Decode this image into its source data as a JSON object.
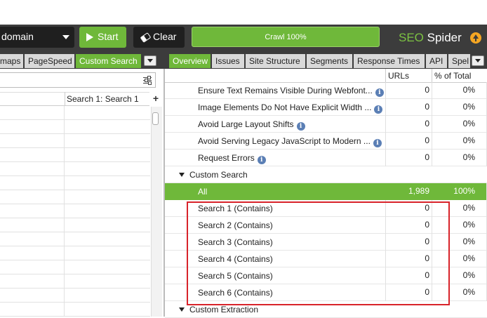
{
  "toolbar": {
    "mode_value": "domain",
    "start_label": "Start",
    "clear_label": "Clear",
    "progress_label": "Crawl 100%",
    "progress_fraction": 1.0
  },
  "brand": {
    "seo": "SEO",
    "spider": "Spider"
  },
  "left_tabs": [
    {
      "label": "maps"
    },
    {
      "label": "PageSpeed"
    },
    {
      "label": "Custom Search",
      "active": true
    }
  ],
  "right_tabs": [
    {
      "label": "Overview",
      "active": true
    },
    {
      "label": "Issues"
    },
    {
      "label": "Site Structure"
    },
    {
      "label": "Segments"
    },
    {
      "label": "Response Times"
    },
    {
      "label": "API"
    },
    {
      "label": "Spel"
    }
  ],
  "left_table": {
    "column": "Search 1: Search 1",
    "add_column": "+"
  },
  "overview": {
    "col_urls": "URLs",
    "col_pct": "% of Total",
    "rows": [
      {
        "label": "Ensure Text Remains Visible During Webfont...",
        "urls": "0",
        "pct": "0%",
        "info": true
      },
      {
        "label": "Image Elements Do Not Have Explicit Width ...",
        "urls": "0",
        "pct": "0%",
        "info": true
      },
      {
        "label": "Avoid Large Layout Shifts",
        "urls": "0",
        "pct": "0%",
        "info": true
      },
      {
        "label": "Avoid Serving Legacy JavaScript to Modern ...",
        "urls": "0",
        "pct": "0%",
        "info": true
      },
      {
        "label": "Request Errors",
        "urls": "0",
        "pct": "0%",
        "info": true
      },
      {
        "label": "Custom Search",
        "group": true
      },
      {
        "label": "All",
        "urls": "1,989",
        "pct": "100%",
        "selected": true
      },
      {
        "label": "Search 1 (Contains)",
        "urls": "0",
        "pct": "0%"
      },
      {
        "label": "Search 2 (Contains)",
        "urls": "0",
        "pct": "0%"
      },
      {
        "label": "Search 3 (Contains)",
        "urls": "0",
        "pct": "0%"
      },
      {
        "label": "Search 4 (Contains)",
        "urls": "0",
        "pct": "0%"
      },
      {
        "label": "Search 5 (Contains)",
        "urls": "0",
        "pct": "0%"
      },
      {
        "label": "Search 6 (Contains)",
        "urls": "0",
        "pct": "0%"
      },
      {
        "label": "Custom Extraction",
        "group": true
      }
    ]
  },
  "colors": {
    "accent_green": "#6fb83a",
    "toolbar_dark": "#3c3c3c",
    "highlight_red": "#d8232a",
    "update_orange": "#f5a623"
  }
}
